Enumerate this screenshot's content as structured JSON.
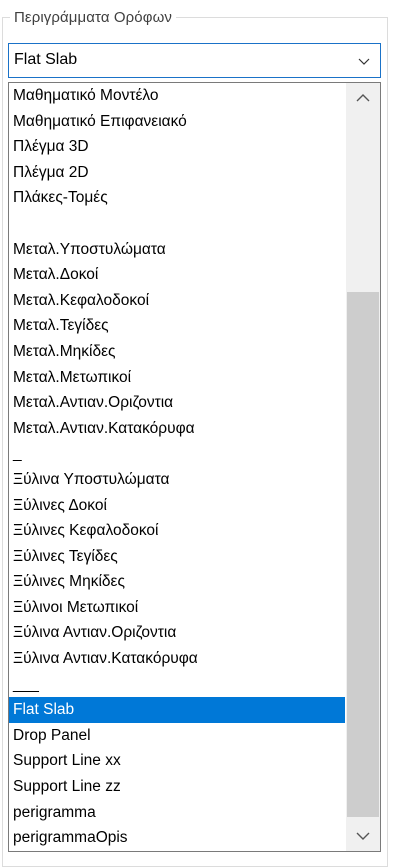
{
  "group": {
    "title": "Περιγράμματα Ορόφων"
  },
  "combo": {
    "selected": "Flat Slab"
  },
  "list": {
    "items": [
      "Μαθηματικό Μοντέλο",
      "Μαθηματικό Επιφανειακό",
      "Πλέγμα 3D",
      "Πλέγμα 2D",
      "Πλάκες-Τομές",
      "",
      "Μεταλ.Υποστυλώματα",
      "Μεταλ.Δοκοί",
      "Μεταλ.Κεφαλοδοκοί",
      "Μεταλ.Τεγίδες",
      "Μεταλ.Μηκίδες",
      "Μεταλ.Μετωπικοί",
      "Μεταλ.Αντιαν.Οριζοντια",
      "Μεταλ.Αντιαν.Κατακόρυφα",
      "_",
      "Ξύλινα Υποστυλώματα",
      "Ξύλινες Δοκοί",
      "Ξύλινες Κεφαλοδοκοί",
      "Ξύλινες Τεγίδες",
      "Ξύλινες Μηκίδες",
      "Ξύλινοι Μετωπικοί",
      "Ξύλινα Αντιαν.Οριζοντια",
      "Ξύλινα Αντιαν.Κατακόρυφα",
      "___",
      "Flat Slab",
      "Drop Panel",
      "Support Line xx",
      "Support Line zz",
      "perigramma",
      "perigrammaOpis"
    ],
    "selected_index": 24
  },
  "icons": {
    "combo_arrow": "chevron-down-icon",
    "scroll_up": "chevron-up-icon",
    "scroll_down": "chevron-down-icon"
  },
  "colors": {
    "selection": "#0078d7",
    "combo_border": "#1a72c8",
    "scroll_thumb": "#cdcdcd",
    "scroll_track": "#f0f0f0"
  }
}
